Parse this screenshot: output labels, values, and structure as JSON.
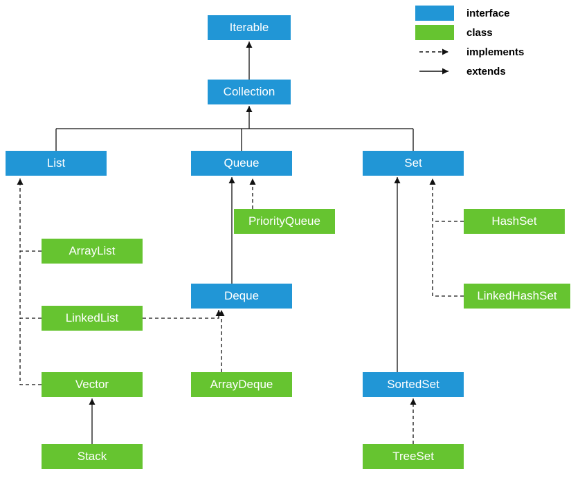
{
  "legend": {
    "interface": "interface",
    "class": "class",
    "implements": "implements",
    "extends": "extends"
  },
  "colors": {
    "interface": "#2196d6",
    "class": "#66c430",
    "line": "#111111"
  },
  "nodes": {
    "iterable": {
      "label": "Iterable",
      "type": "interface"
    },
    "collection": {
      "label": "Collection",
      "type": "interface"
    },
    "list": {
      "label": "List",
      "type": "interface"
    },
    "queue": {
      "label": "Queue",
      "type": "interface"
    },
    "set": {
      "label": "Set",
      "type": "interface"
    },
    "deque": {
      "label": "Deque",
      "type": "interface"
    },
    "sortedset": {
      "label": "SortedSet",
      "type": "interface"
    },
    "arraylist": {
      "label": "ArrayList",
      "type": "class"
    },
    "linkedlist": {
      "label": "LinkedList",
      "type": "class"
    },
    "vector": {
      "label": "Vector",
      "type": "class"
    },
    "stack": {
      "label": "Stack",
      "type": "class"
    },
    "priorityqueue": {
      "label": "PriorityQueue",
      "type": "class"
    },
    "arraydeque": {
      "label": "ArrayDeque",
      "type": "class"
    },
    "hashset": {
      "label": "HashSet",
      "type": "class"
    },
    "linkedhashset": {
      "label": "LinkedHashSet",
      "type": "class"
    },
    "treeset": {
      "label": "TreeSet",
      "type": "class"
    }
  },
  "edges": [
    {
      "from": "collection",
      "to": "iterable",
      "kind": "extends"
    },
    {
      "from": "list",
      "to": "collection",
      "kind": "extends"
    },
    {
      "from": "queue",
      "to": "collection",
      "kind": "extends"
    },
    {
      "from": "set",
      "to": "collection",
      "kind": "extends"
    },
    {
      "from": "deque",
      "to": "queue",
      "kind": "extends"
    },
    {
      "from": "sortedset",
      "to": "set",
      "kind": "extends"
    },
    {
      "from": "stack",
      "to": "vector",
      "kind": "extends"
    },
    {
      "from": "arraylist",
      "to": "list",
      "kind": "implements"
    },
    {
      "from": "linkedlist",
      "to": "list",
      "kind": "implements"
    },
    {
      "from": "linkedlist",
      "to": "deque",
      "kind": "implements"
    },
    {
      "from": "vector",
      "to": "list",
      "kind": "implements"
    },
    {
      "from": "priorityqueue",
      "to": "queue",
      "kind": "implements"
    },
    {
      "from": "arraydeque",
      "to": "deque",
      "kind": "implements"
    },
    {
      "from": "hashset",
      "to": "set",
      "kind": "implements"
    },
    {
      "from": "linkedhashset",
      "to": "set",
      "kind": "implements"
    },
    {
      "from": "treeset",
      "to": "sortedset",
      "kind": "implements"
    }
  ]
}
